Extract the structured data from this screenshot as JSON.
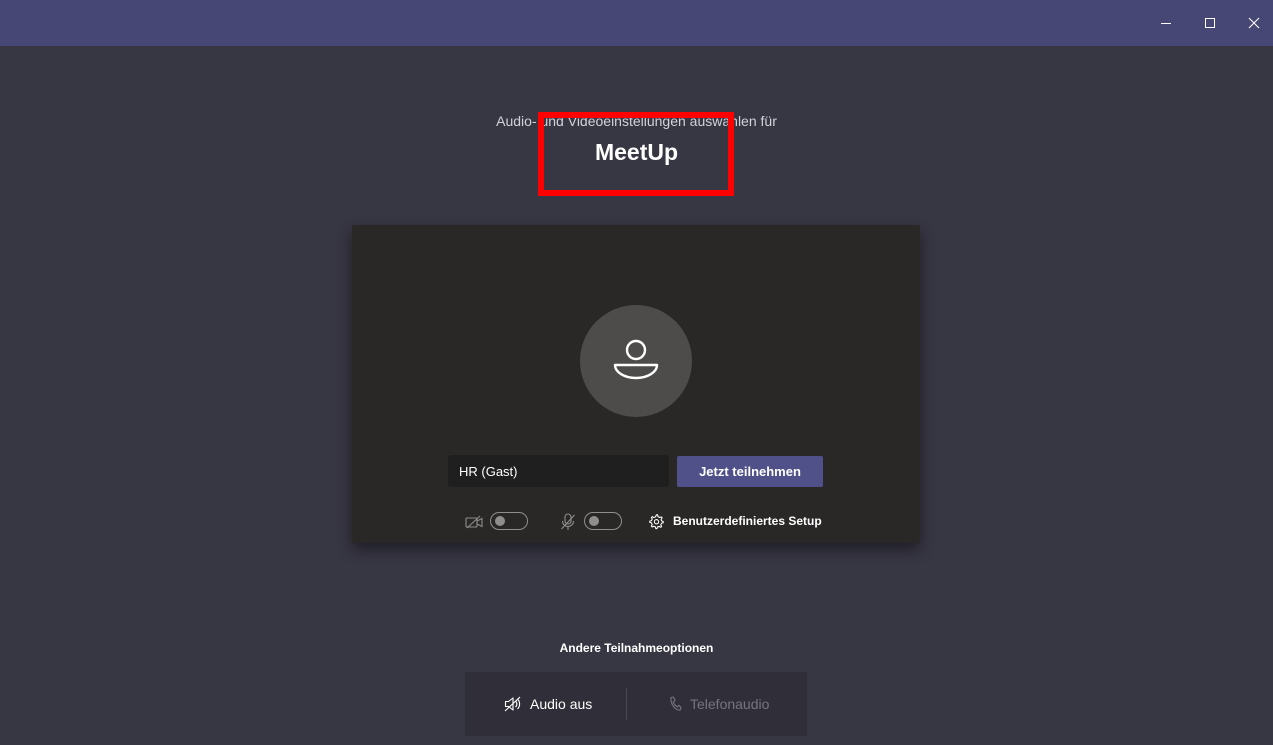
{
  "window": {
    "controls": [
      "minimize",
      "maximize",
      "close"
    ]
  },
  "header": {
    "subtitle": "Audio- und Videoeinstellungen auswählen für",
    "meeting_title": "MeetUp"
  },
  "preview": {
    "name_value": "HR (Gast)",
    "join_label": "Jetzt teilnehmen",
    "camera_toggle_on": false,
    "mic_toggle_on": false,
    "setup_label": "Benutzerdefiniertes Setup"
  },
  "other_options": {
    "heading": "Andere Teilnahmeoptionen",
    "audio_off_label": "Audio aus",
    "phone_audio_label": "Telefonaudio"
  },
  "colors": {
    "background": "#373643",
    "titlebar": "#464775",
    "card": "#292827",
    "accent": "#4f5188",
    "highlight": "#ff0000"
  },
  "icons": {
    "avatar": "person-icon",
    "camera": "camera-off-icon",
    "mic": "mic-off-icon",
    "setup": "gear-icon",
    "audio_off": "speaker-off-icon",
    "phone": "phone-icon"
  }
}
